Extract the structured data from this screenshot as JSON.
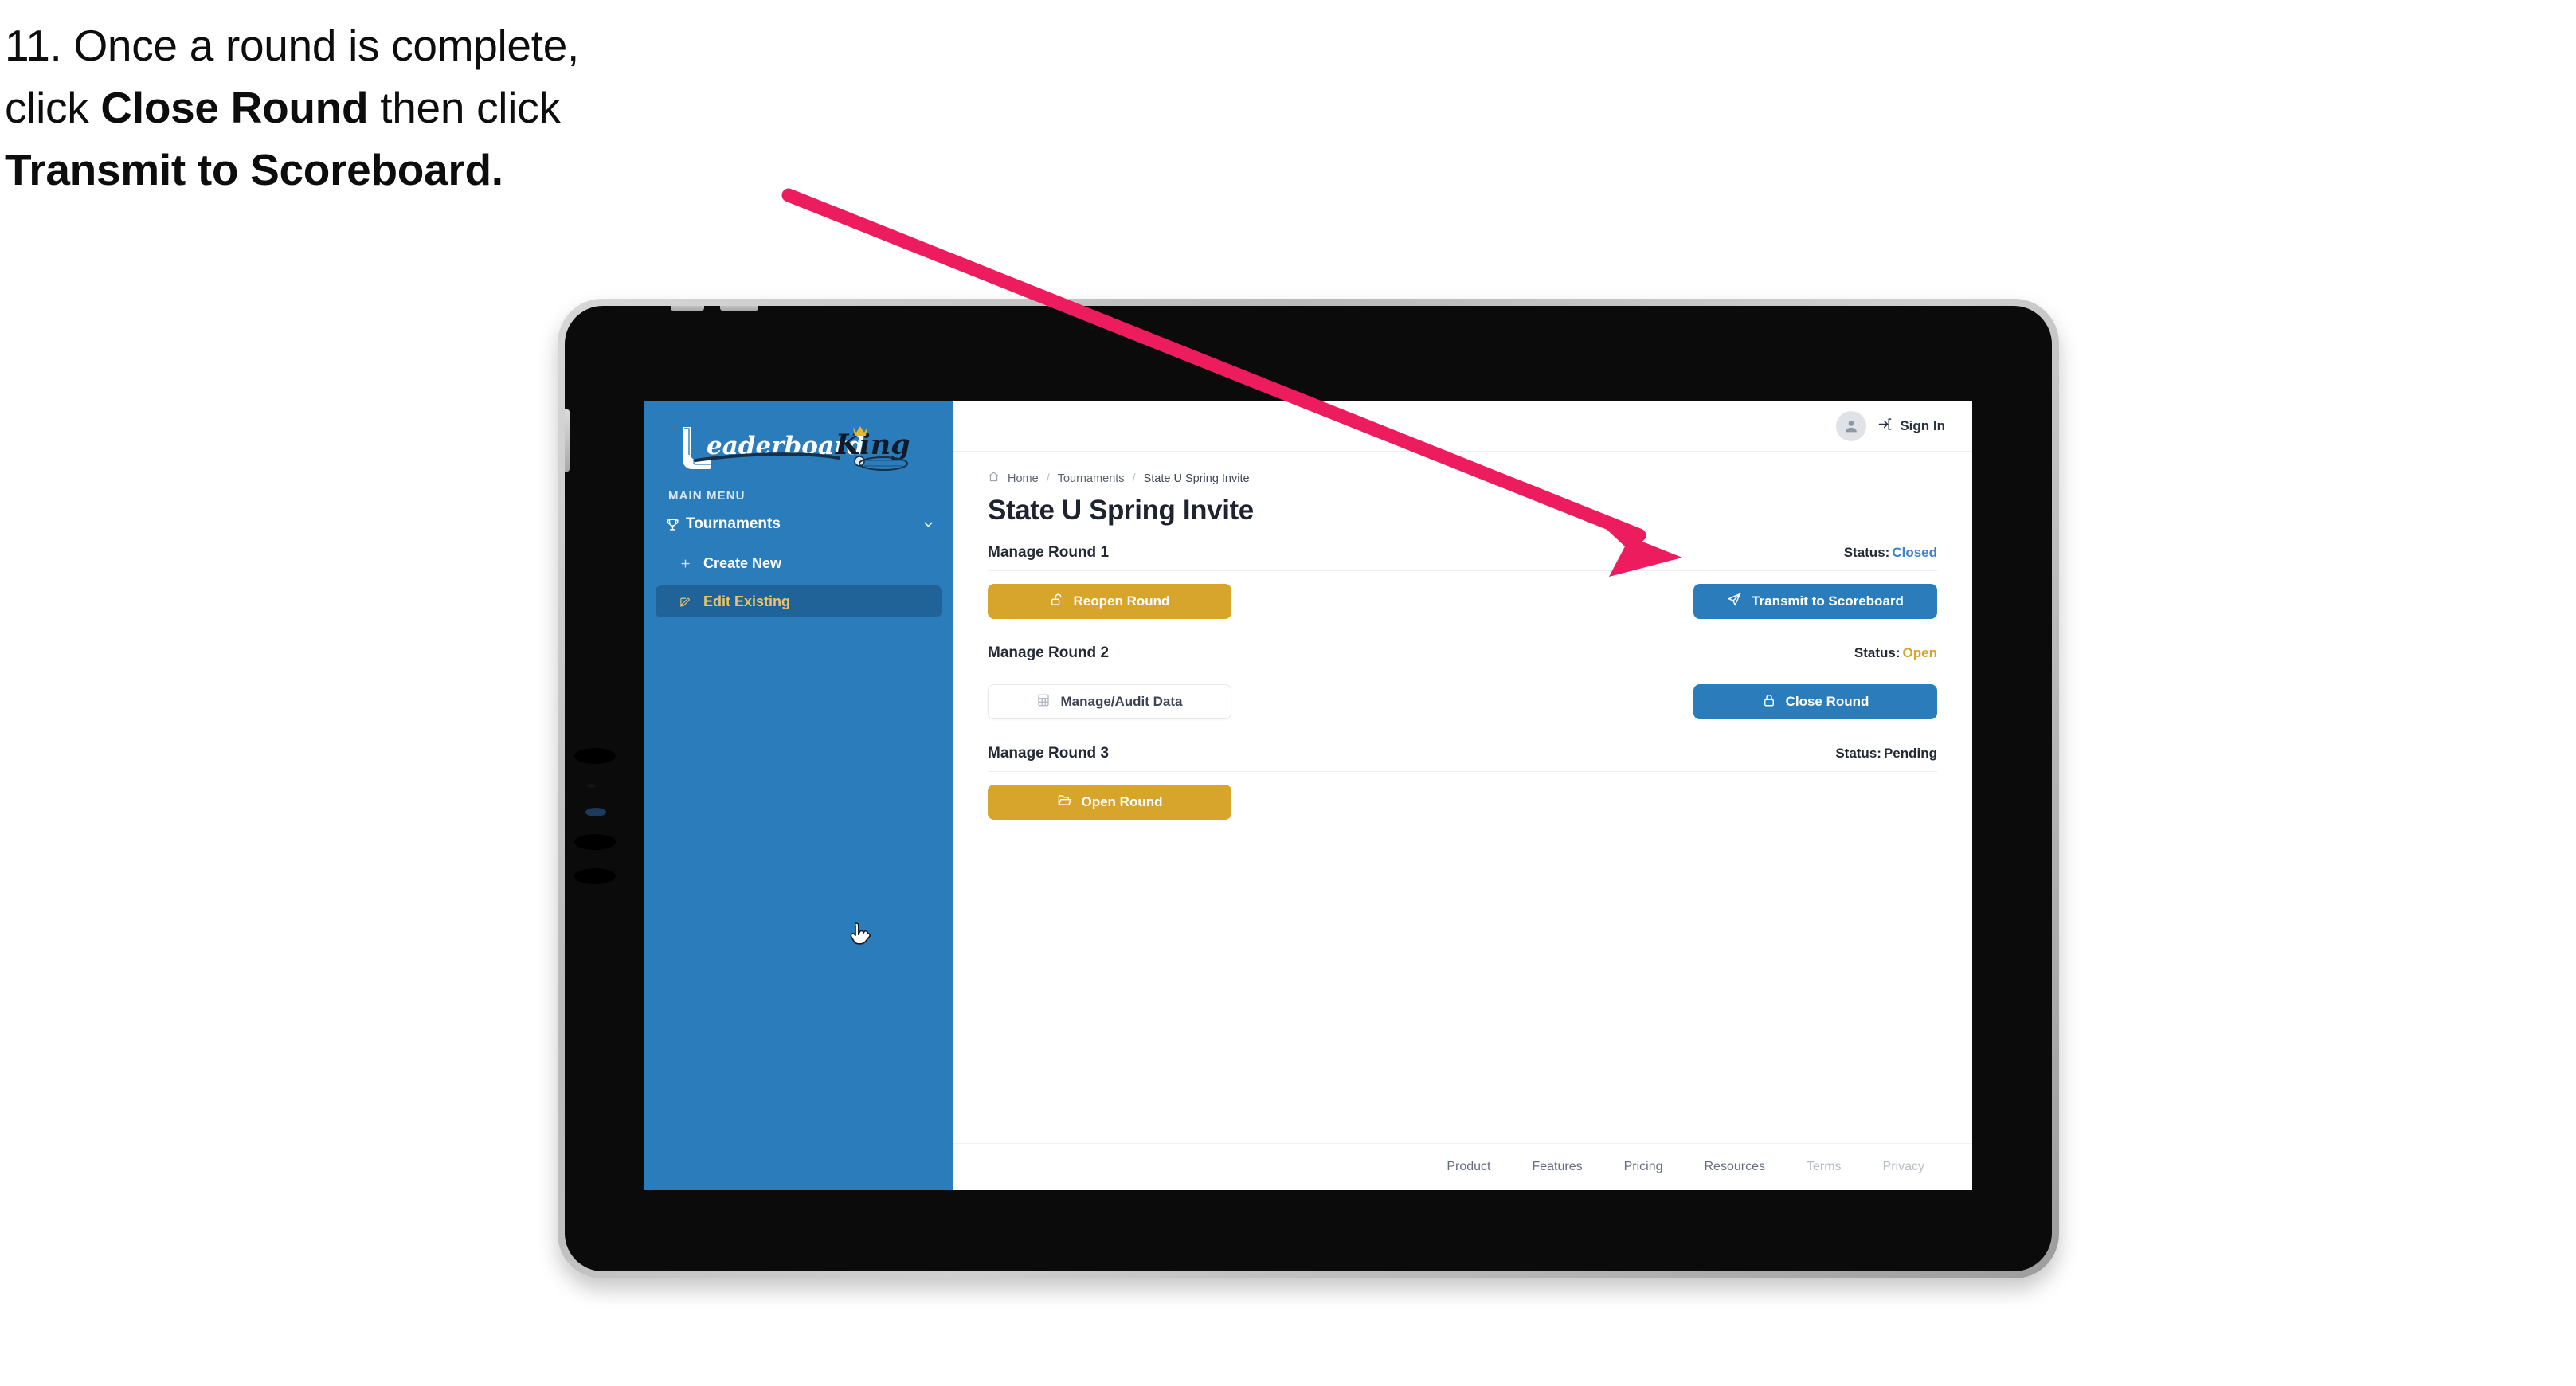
{
  "caption": {
    "line1_prefix": "11. Once a round is complete,",
    "line2_prefix": "click ",
    "line2_bold": "Close Round",
    "line2_suffix": " then click",
    "line3_bold": "Transmit to Scoreboard."
  },
  "colors": {
    "accent_blue": "#2b7cba",
    "accent_amber": "#d7a42c",
    "sidebar_blue": "#2b7cba",
    "sidebar_active": "#1f6399",
    "sidebar_active_text": "#e8c46a",
    "status_closed": "#3b82cf",
    "status_open": "#d9a22b",
    "status_pending": "#232a36",
    "arrow_pink": "#ec1c5e"
  },
  "sidebar": {
    "logo_primary": "Leaderboard",
    "logo_secondary": "King",
    "menu_label": "MAIN MENU",
    "items": [
      {
        "label": "Tournaments",
        "icon": "trophy-icon",
        "chevron": "chevron-down-icon",
        "active": false
      },
      {
        "label": "Create New",
        "icon": "plus-icon",
        "active": false
      },
      {
        "label": "Edit Existing",
        "icon": "pencil-square-icon",
        "active": true
      }
    ]
  },
  "topbar": {
    "avatar_icon": "user-avatar-icon",
    "signin_icon": "sign-in-arrow-icon",
    "signin_label": "Sign In"
  },
  "breadcrumb": {
    "home_icon": "home-icon",
    "items": [
      "Home",
      "Tournaments",
      "State U Spring Invite"
    ],
    "separator": "/"
  },
  "page": {
    "title": "State U Spring Invite"
  },
  "rounds": [
    {
      "title": "Manage Round 1",
      "status_label": "Status:",
      "status_value": "Closed",
      "status_color": "#3b82cf",
      "left_button": {
        "label": "Reopen Round",
        "icon": "unlock-icon",
        "style": "amber"
      },
      "right_button": {
        "label": "Transmit to Scoreboard",
        "icon": "paper-plane-icon",
        "style": "blue"
      }
    },
    {
      "title": "Manage Round 2",
      "status_label": "Status:",
      "status_value": "Open",
      "status_color": "#d9a22b",
      "left_button": {
        "label": "Manage/Audit Data",
        "icon": "table-grid-icon",
        "style": "ghost"
      },
      "right_button": {
        "label": "Close Round",
        "icon": "lock-closed-icon",
        "style": "blue"
      }
    },
    {
      "title": "Manage Round 3",
      "status_label": "Status:",
      "status_value": "Pending",
      "status_color": "#232a36",
      "left_button": {
        "label": "Open Round",
        "icon": "folder-open-icon",
        "style": "amber"
      },
      "right_button": null
    }
  ],
  "footer": {
    "links": [
      {
        "label": "Product",
        "muted": false
      },
      {
        "label": "Features",
        "muted": false
      },
      {
        "label": "Pricing",
        "muted": false
      },
      {
        "label": "Resources",
        "muted": false
      },
      {
        "label": "Terms",
        "muted": true
      },
      {
        "label": "Privacy",
        "muted": true
      }
    ]
  },
  "annotation": {
    "arrow_name": "callout-arrow",
    "cursor_name": "hand-cursor"
  }
}
